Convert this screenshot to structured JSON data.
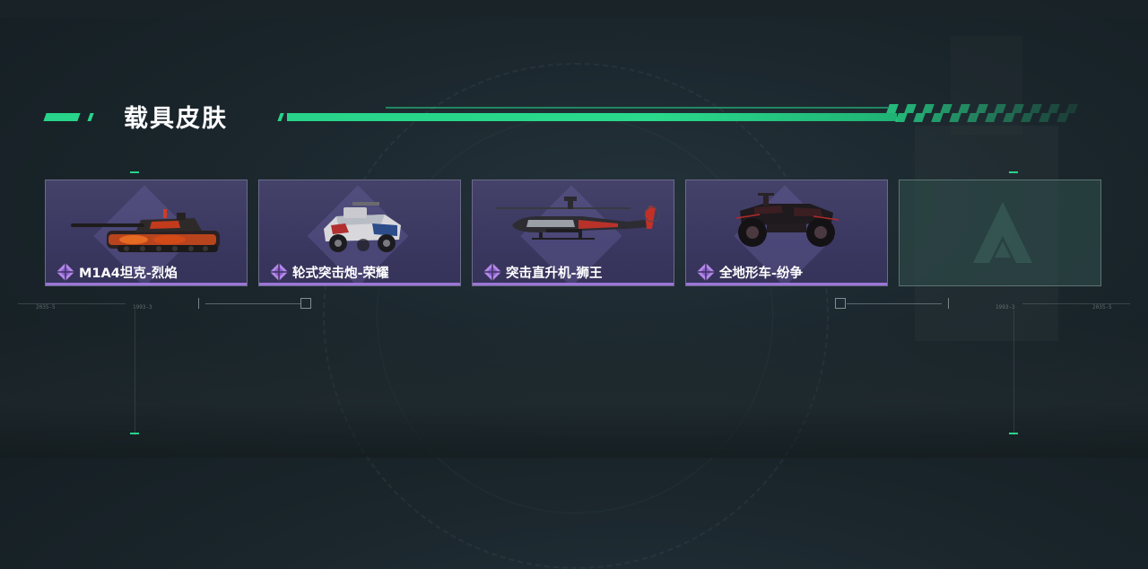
{
  "header": {
    "title": "载具皮肤"
  },
  "colors": {
    "accent": "#27d489",
    "card_bg": "#3d3a63",
    "card_underline": "#9a76d6",
    "empty_slot": "#32504e"
  },
  "cards": [
    {
      "name": "M1A4坦克-烈焰",
      "icon": "tank-icon",
      "rarity_icon": "purple-gem-icon"
    },
    {
      "name": "轮式突击炮-荣耀",
      "icon": "armored-car-icon",
      "rarity_icon": "purple-gem-icon"
    },
    {
      "name": "突击直升机-狮王",
      "icon": "helicopter-icon",
      "rarity_icon": "purple-gem-icon"
    },
    {
      "name": "全地形车-纷争",
      "icon": "atv-icon",
      "rarity_icon": "purple-gem-icon"
    },
    {
      "name": "",
      "icon": "empty-slot-logo-icon",
      "rarity_icon": ""
    }
  ],
  "hud": {
    "left_code_1": "2035-5",
    "left_code_2": "1993-3",
    "right_code_1": "1993-3",
    "right_code_2": "2035-5"
  }
}
